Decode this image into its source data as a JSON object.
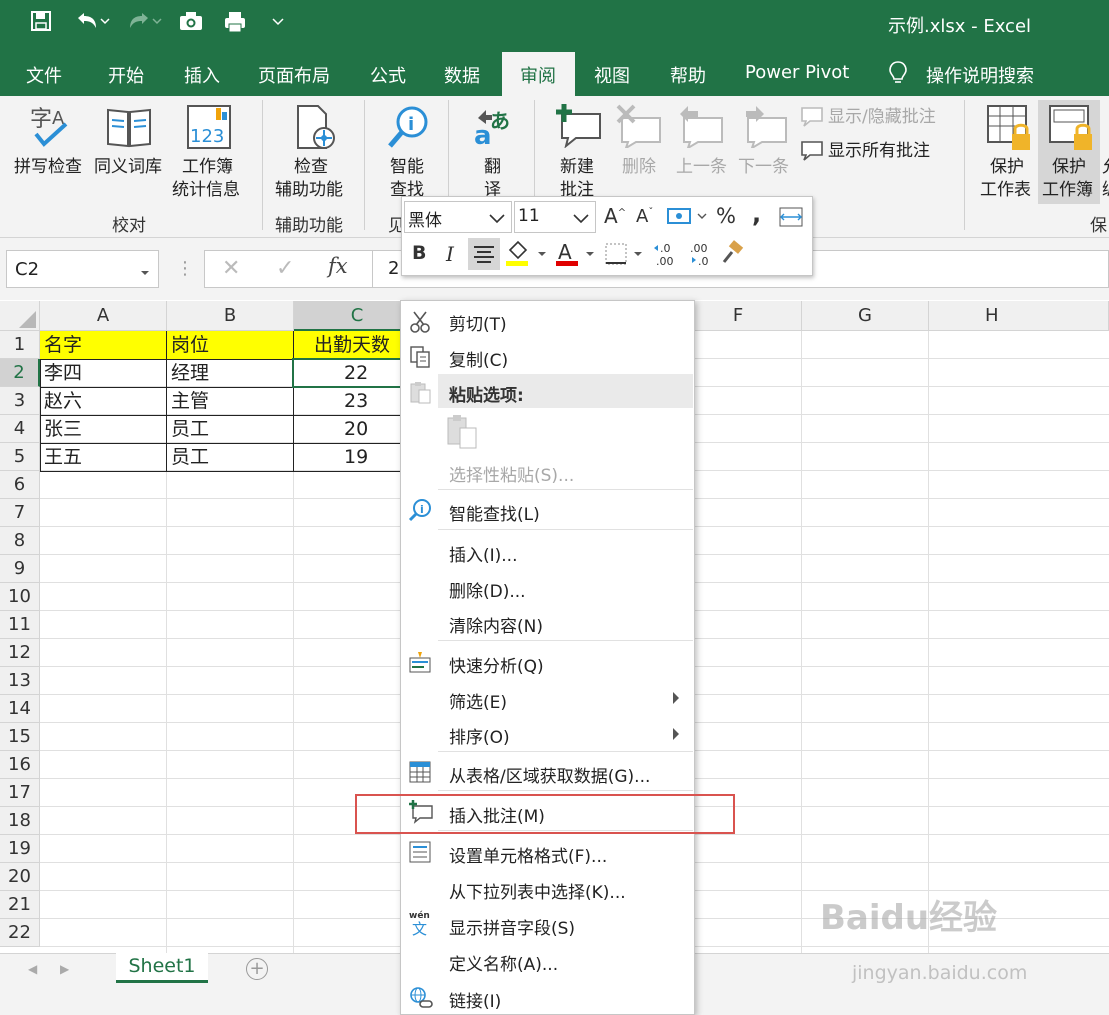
{
  "window": {
    "title": "示例.xlsx  -  Excel"
  },
  "tabs": [
    "文件",
    "开始",
    "插入",
    "页面布局",
    "公式",
    "数据",
    "审阅",
    "视图",
    "帮助",
    "Power Pivot",
    "操作说明搜索"
  ],
  "ribbon": {
    "spelling": "拼写检查",
    "thesaurus": "同义词库",
    "workbook_stats_1": "工作簿",
    "workbook_stats_2": "统计信息",
    "group_proofing": "校对",
    "check_access_1": "检查",
    "check_access_2": "辅助功能",
    "group_access": "辅助功能",
    "smart_lookup_1": "智能",
    "smart_lookup_2": "查找",
    "group_insights": "见",
    "translate_1": "翻",
    "translate_2": "译",
    "new_comment_1": "新建",
    "new_comment_2": "批注",
    "delete_comment": "删除",
    "prev_comment": "上一条",
    "next_comment": "下一条",
    "show_hide_comment": "显示/隐藏批注",
    "show_all_comments": "显示所有批注",
    "protect_sheet_1": "保护",
    "protect_sheet_2": "工作表",
    "protect_book_1": "保护",
    "protect_book_2": "工作簿",
    "group_protect": "保",
    "cut_off_1": "允",
    "cut_off_2": "编"
  },
  "formula_bar": {
    "name_box": "C2",
    "fx": "fx",
    "value": "2"
  },
  "columns": [
    "A",
    "B",
    "C",
    "",
    "",
    "F",
    "G",
    "H"
  ],
  "rows": [
    "1",
    "2",
    "3",
    "4",
    "5",
    "6",
    "7",
    "8",
    "9",
    "10",
    "11",
    "12",
    "13",
    "14",
    "15",
    "16",
    "17",
    "18",
    "19",
    "20",
    "21",
    "22"
  ],
  "table": [
    [
      "名字",
      "岗位",
      "出勤天数"
    ],
    [
      "李四",
      "经理",
      "22"
    ],
    [
      "赵六",
      "主管",
      "23"
    ],
    [
      "张三",
      "员工",
      "20"
    ],
    [
      "王五",
      "员工",
      "19"
    ]
  ],
  "mini_toolbar": {
    "font": "黑体",
    "size": "11",
    "bold": "B",
    "italic": "I",
    "percent": "%",
    "comma": ","
  },
  "context_menu": {
    "cut": "剪切(T)",
    "copy": "复制(C)",
    "paste_options": "粘贴选项:",
    "paste_special": "选择性粘贴(S)...",
    "smart_lookup": "智能查找(L)",
    "insert": "插入(I)...",
    "delete": "删除(D)...",
    "clear": "清除内容(N)",
    "quick_analysis": "快速分析(Q)",
    "filter": "筛选(E)",
    "sort": "排序(O)",
    "get_data": "从表格/区域获取数据(G)...",
    "insert_comment": "插入批注(M)",
    "format_cells": "设置单元格格式(F)...",
    "pick_list": "从下拉列表中选择(K)...",
    "phonetic": "显示拼音字段(S)",
    "define_name": "定义名称(A)...",
    "link": "链接(I)"
  },
  "sheet_tab": "Sheet1",
  "watermark": {
    "brand": "Baidu经验",
    "url": "jingyan.baidu.com"
  },
  "colors": {
    "excel_green": "#217346",
    "header_yellow": "#ffff00",
    "highlight_red": "#d9534f"
  }
}
